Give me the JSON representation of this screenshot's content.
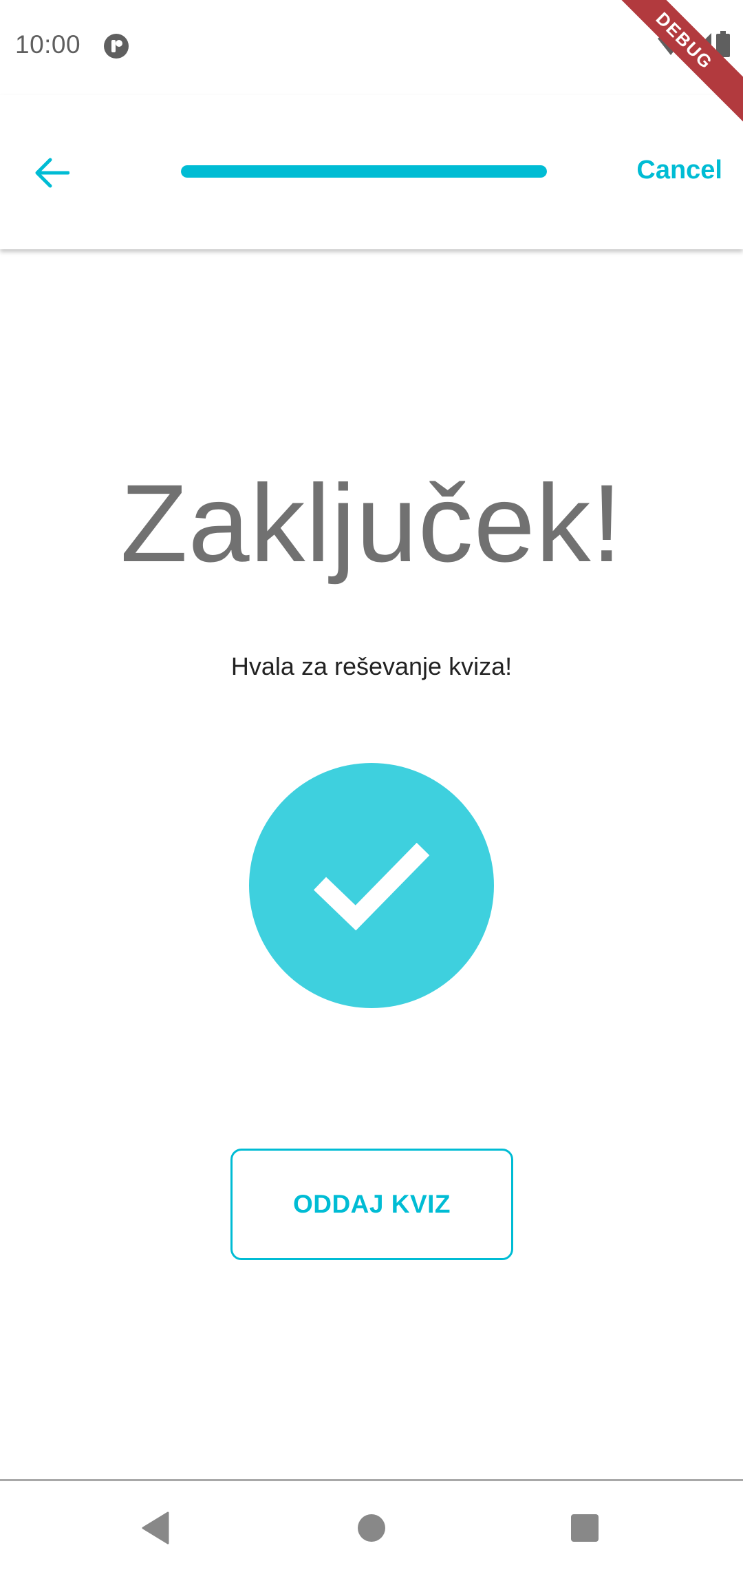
{
  "status_bar": {
    "time": "10:00",
    "notification_icon": "app-notification-icon",
    "icons": [
      "wifi-icon",
      "signal-icon",
      "battery-icon"
    ]
  },
  "debug_banner": {
    "label": "DEBUG",
    "color": "#b23a3e"
  },
  "app_bar": {
    "back_icon": "arrow-left-icon",
    "progress": 1.0,
    "cancel_label": "Cancel"
  },
  "main": {
    "title": "Zaključek!",
    "subtitle": "Hvala za reševanje kviza!",
    "check_icon": "check-circle-icon",
    "submit_label": "ODDAJ KVIZ"
  },
  "nav_bar": {
    "items": [
      "back-triangle-icon",
      "home-circle-icon",
      "recents-square-icon"
    ]
  },
  "colors": {
    "accent": "#00bcd4",
    "circle": "#3ed0de",
    "title_text": "#717171",
    "body_text": "#222222"
  }
}
